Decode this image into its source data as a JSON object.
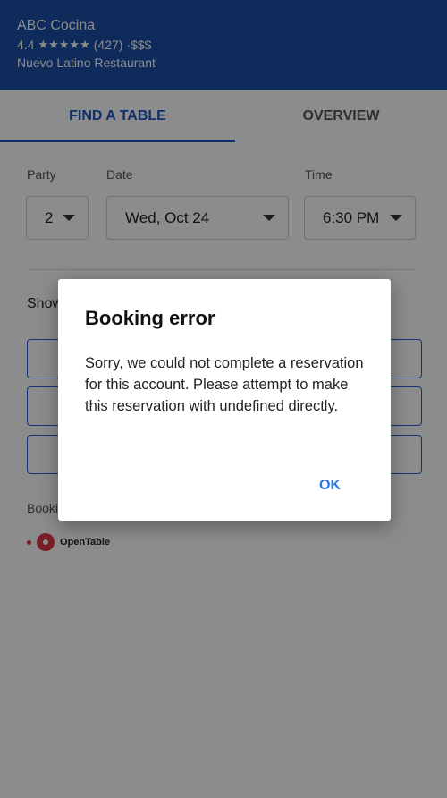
{
  "header": {
    "name": "ABC Cocina",
    "rating": "4.4",
    "stars": "★★★★★",
    "reviews": "(427)",
    "price": "·$$$",
    "type": "Nuevo Latino Restaurant"
  },
  "tabs": [
    {
      "label": "FIND A TABLE",
      "active": true
    },
    {
      "label": "OVERVIEW",
      "active": false
    }
  ],
  "form": {
    "party": {
      "label": "Party",
      "value": "2"
    },
    "date": {
      "label": "Date",
      "value": "Wed, Oct 24"
    },
    "time": {
      "label": "Time",
      "value": "6:30 PM"
    }
  },
  "show_label": "Show",
  "booking_label": "Booki",
  "provider": {
    "name": "OpenTable",
    "mark": "·"
  },
  "dialog": {
    "title": "Booking error",
    "message": "Sorry, we could not complete a reservation for this account. Please attempt to make this reservation with undefined directly.",
    "ok_label": "OK"
  },
  "colors": {
    "header_bg": "#1a4fa6",
    "accent": "#1a56c2",
    "ok": "#2c77e3",
    "opentable": "#da3743"
  }
}
